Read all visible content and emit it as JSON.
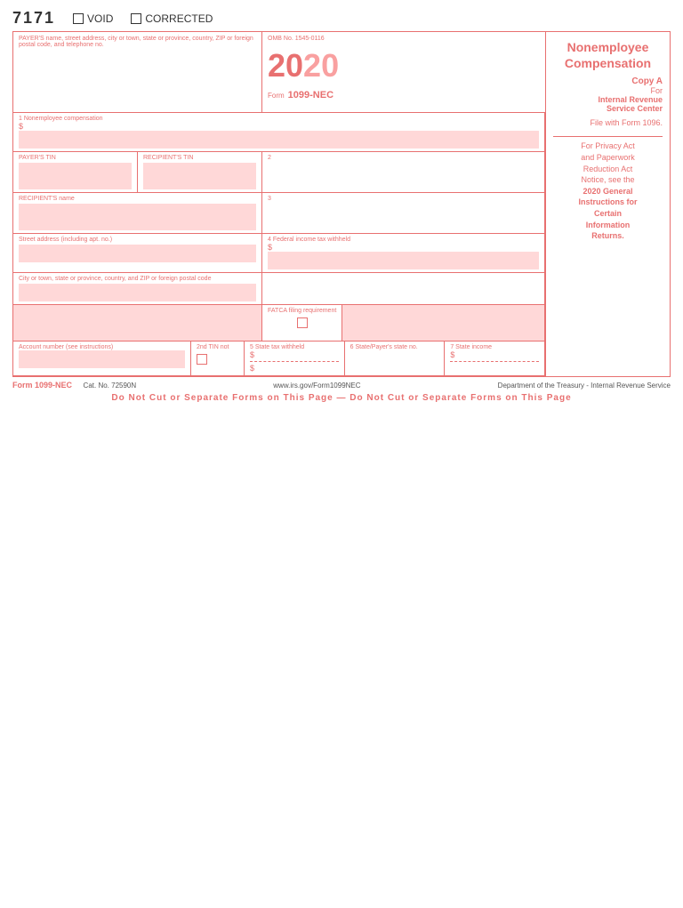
{
  "form": {
    "number_top": "7171",
    "void_label": "VOID",
    "corrected_label": "CORRECTED",
    "omb_number": "OMB No. 1545-0116",
    "year_left": "20",
    "year_right": "20",
    "form_label": "Form",
    "form_name": "1099-NEC",
    "title": "Nonemployee",
    "title2": "Compensation",
    "copy_label": "Copy A",
    "for_label": "For",
    "irs_label": "Internal Revenue",
    "service_label": "Service Center",
    "file_label": "File with Form 1096.",
    "privacy_line1": "For Privacy Act",
    "privacy_line2": "and Paperwork",
    "privacy_line3": "Reduction Act",
    "privacy_line4": "Notice, see the",
    "privacy_line5": "2020 General",
    "privacy_line6": "Instructions for",
    "privacy_line7": "Certain",
    "privacy_line8": "Information",
    "privacy_line9": "Returns.",
    "payer_address_label": "PAYER'S name, street address, city or town, state or province, country, ZIP or foreign postal code, and telephone no.",
    "payer_tin_label": "PAYER'S TIN",
    "recipient_tin_label": "RECIPIENT'S TIN",
    "recipient_name_label": "RECIPIENT'S name",
    "street_label": "Street address (including apt. no.)",
    "city_label": "City or town, state or province, country, and ZIP or foreign postal code",
    "account_label": "Account number (see instructions)",
    "fatca_label": "FATCA filing requirement",
    "tin2nd_label": "2nd TIN not",
    "field1_label": "1 Nonemployee compensation",
    "field1_dollar": "$",
    "field2_label": "2",
    "field3_label": "3",
    "field4_label": "4 Federal income tax withheld",
    "field4_dollar": "$",
    "field5_label": "5 State tax withheld",
    "field5_dollar": "$",
    "field5_dollar2": "$",
    "field6_label": "6 State/Payer's state no.",
    "field7_label": "7 State income",
    "field7_dollar": "$",
    "footer_form": "Form 1099-NEC",
    "footer_cat": "Cat. No. 72590N",
    "footer_url": "www.irs.gov/Form1099NEC",
    "footer_dept": "Department of the Treasury - Internal Revenue Service",
    "do_not_cut": "Do Not Cut or Separate Forms on This Page — Do Not Cut or Separate Forms on This Page"
  }
}
